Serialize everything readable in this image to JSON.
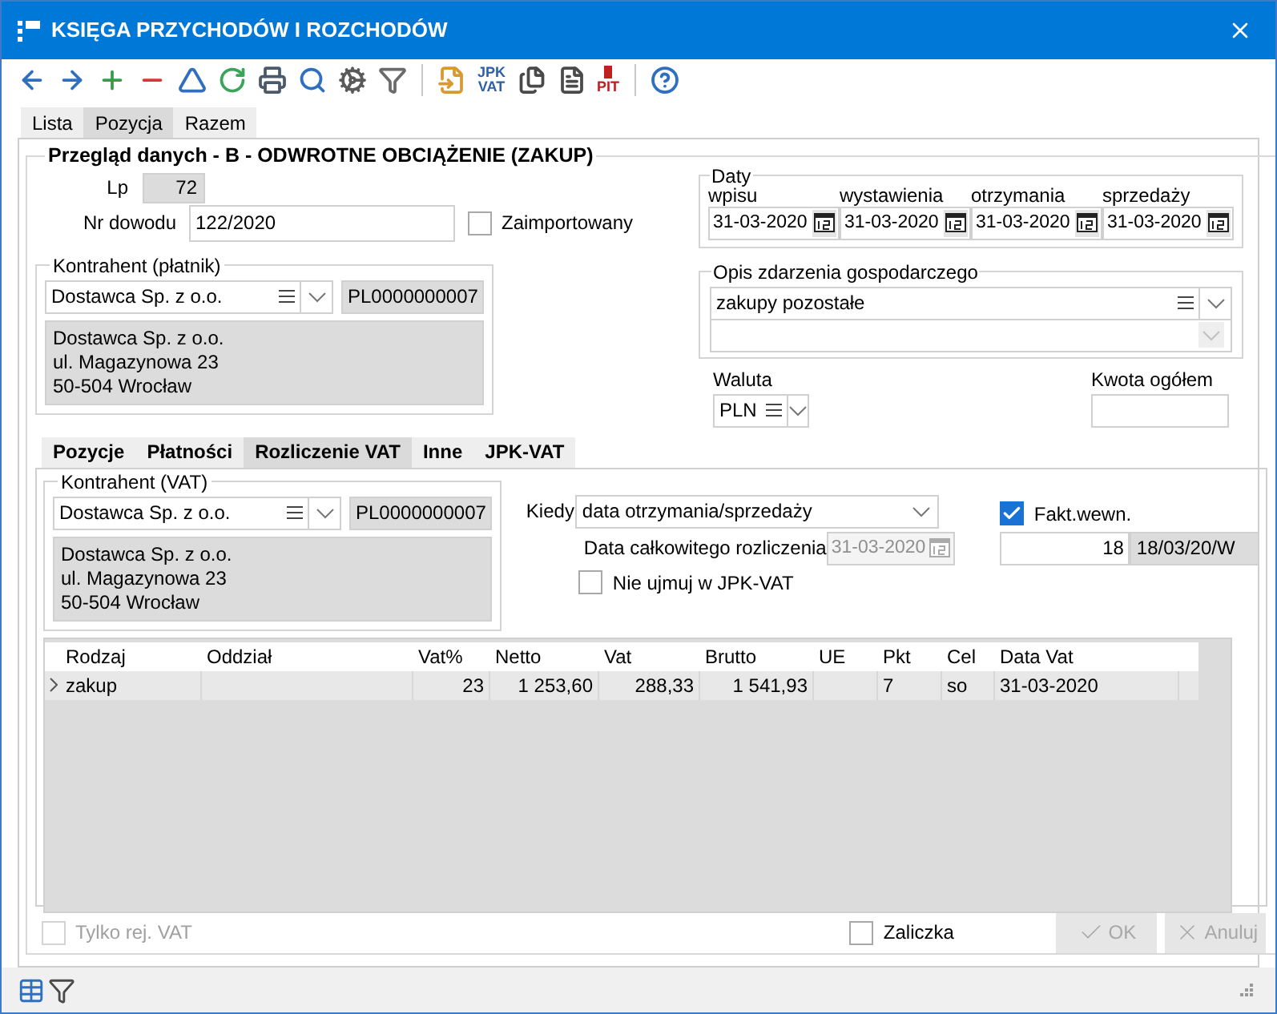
{
  "window": {
    "title": "KSIĘGA PRZYCHODÓW I ROZCHODÓW"
  },
  "toolbar": [
    {
      "kind": "back"
    },
    {
      "kind": "forward"
    },
    {
      "kind": "add"
    },
    {
      "kind": "remove"
    },
    {
      "kind": "triangle"
    },
    {
      "kind": "refresh"
    },
    {
      "kind": "print"
    },
    {
      "kind": "search"
    },
    {
      "kind": "gears"
    },
    {
      "kind": "filter"
    },
    {
      "kind": "separator"
    },
    {
      "kind": "import"
    },
    {
      "kind": "text",
      "lines": [
        "JPK",
        "VAT"
      ]
    },
    {
      "kind": "copy"
    },
    {
      "kind": "document"
    },
    {
      "kind": "pit",
      "lines": [
        "PIT"
      ]
    },
    {
      "kind": "separator"
    },
    {
      "kind": "help"
    }
  ],
  "tabs": [
    {
      "label": "Lista",
      "selected": false
    },
    {
      "label": "Pozycja",
      "selected": true
    },
    {
      "label": "Razem",
      "selected": false
    }
  ],
  "header": "Przegląd danych - B - ODWROTNE OBCIĄŻENIE (ZAKUP)",
  "lp": {
    "label": "Lp",
    "value": "72"
  },
  "nr_dowodu": {
    "label": "Nr dowodu",
    "value": "122/2020"
  },
  "zaimportowany": {
    "label": "Zaimportowany",
    "checked": false
  },
  "kontrahent": {
    "legend": "Kontrahent (płatnik)",
    "name": "Dostawca Sp. z o.o.",
    "nip": "PL0000000007",
    "address": [
      "Dostawca Sp. z o.o.",
      "ul. Magazynowa 23",
      "50-504 Wrocław"
    ]
  },
  "daty": {
    "legend": "Daty",
    "items": [
      {
        "label": "wpisu",
        "value": "31-03-2020"
      },
      {
        "label": "wystawienia",
        "value": "31-03-2020"
      },
      {
        "label": "otrzymania",
        "value": "31-03-2020"
      },
      {
        "label": "sprzedaży",
        "value": "31-03-2020"
      }
    ]
  },
  "opis": {
    "legend": "Opis zdarzenia gospodarczego",
    "value": "zakupy pozostałe"
  },
  "waluta": {
    "label": "Waluta",
    "value": "PLN"
  },
  "kwota": {
    "label": "Kwota ogółem"
  },
  "subtabs": [
    {
      "label": "Pozycje",
      "selected": false
    },
    {
      "label": "Płatności",
      "selected": false
    },
    {
      "label": "Rozliczenie VAT",
      "selected": true
    },
    {
      "label": "Inne",
      "selected": false
    },
    {
      "label": "JPK-VAT",
      "selected": false
    }
  ],
  "kontrahent_vat": {
    "legend": "Kontrahent (VAT)",
    "name": "Dostawca Sp. z o.o.",
    "nip": "PL0000000007",
    "address": [
      "Dostawca Sp. z o.o.",
      "ul. Magazynowa 23",
      "50-504 Wrocław"
    ]
  },
  "kiedy": {
    "label": "Kiedy",
    "value": "data otrzymania/sprzedaży"
  },
  "data_rozliczenia": {
    "label": "Data całkowitego rozliczenia",
    "value": "31-03-2020",
    "disabled": true
  },
  "nie_ujmuj": {
    "label": "Nie ujmuj w JPK-VAT",
    "checked": false
  },
  "fakt_wewn": {
    "label": "Fakt.wewn.",
    "checked": true,
    "number": "18",
    "value": "18/03/20/W"
  },
  "table": {
    "columns": [
      {
        "label": "Rodzaj",
        "kind": "text"
      },
      {
        "label": "Oddział",
        "kind": "text"
      },
      {
        "label": "Vat%",
        "kind": "number"
      },
      {
        "label": "Netto",
        "kind": "number"
      },
      {
        "label": "Vat",
        "kind": "number"
      },
      {
        "label": "Brutto",
        "kind": "number"
      },
      {
        "label": "UE",
        "kind": "text"
      },
      {
        "label": "Pkt",
        "kind": "text"
      },
      {
        "label": "Cel",
        "kind": "text"
      },
      {
        "label": "Data Vat",
        "kind": "text"
      }
    ],
    "rows": [
      {
        "cells": [
          "zakup",
          "",
          "23",
          "1 253,60",
          "288,33",
          "1 541,93",
          "",
          "7",
          "so",
          "31-03-2020"
        ],
        "selected": true
      }
    ]
  },
  "tylko_rej": {
    "label": "Tylko rej. VAT",
    "checked": false,
    "disabled": true
  },
  "zaliczka": {
    "label": "Zaliczka",
    "checked": false,
    "disabled": false
  },
  "buttons": [
    {
      "kind": "ok",
      "label": "OK",
      "disabled": true
    },
    {
      "kind": "cancel",
      "label": "Anuluj",
      "disabled": true
    }
  ]
}
